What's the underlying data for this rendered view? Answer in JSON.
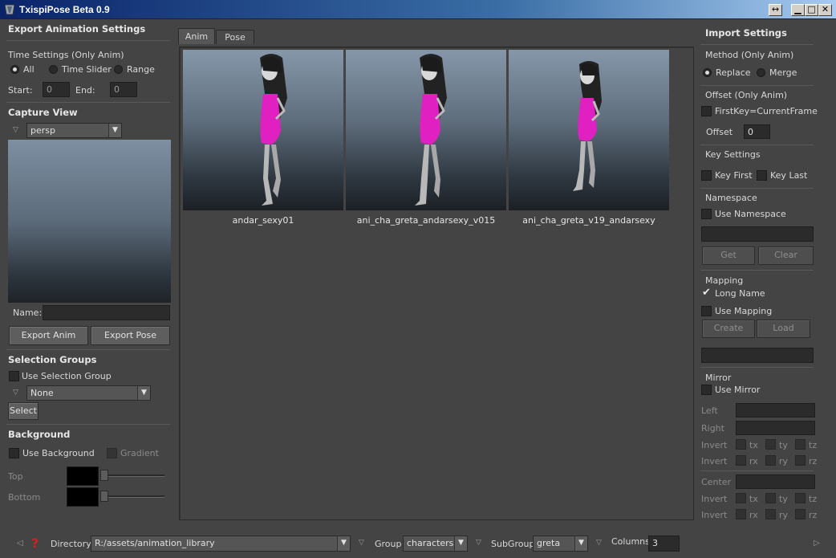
{
  "window": {
    "title": "TxispiPose Beta 0.9"
  },
  "export": {
    "title": "Export Animation Settings",
    "time_settings_label": "Time Settings (Only Anim)",
    "time_options": [
      "All",
      "Time Slider",
      "Range"
    ],
    "time_selected": "All",
    "start_label": "Start:",
    "start_value": "0",
    "end_label": "End:",
    "end_value": "0",
    "capture_view_title": "Capture View",
    "camera_value": "persp",
    "name_label": "Name:",
    "name_value": "",
    "export_anim_label": "Export Anim",
    "export_pose_label": "Export Pose"
  },
  "selection_groups": {
    "title": "Selection Groups",
    "use_label": "Use Selection Group",
    "group_value": "None",
    "select_label": "Select"
  },
  "background": {
    "title": "Background",
    "use_label": "Use Background",
    "gradient_label": "Gradient",
    "top_label": "Top",
    "bottom_label": "Bottom",
    "top_color": "#000000",
    "bottom_color": "#000000"
  },
  "tabs": [
    {
      "label": "Anim"
    },
    {
      "label": "Pose"
    }
  ],
  "active_tab": "Anim",
  "thumbnails": [
    {
      "caption": "andar_sexy01"
    },
    {
      "caption": "ani_cha_greta_andarsexy_v015"
    },
    {
      "caption": "ani_cha_greta_v19_andarsexy"
    }
  ],
  "import": {
    "title": "Import Settings",
    "method_label": "Method (Only Anim)",
    "method_options": [
      "Replace",
      "Merge"
    ],
    "method_selected": "Replace",
    "offset_section": "Offset (Only Anim)",
    "firstkey_label": "FirstKey=CurrentFrame",
    "offset_label": "Offset",
    "offset_value": "0",
    "key_settings": "Key Settings",
    "key_first": "Key First",
    "key_last": "Key Last",
    "namespace_section": "Namespace",
    "use_namespace": "Use Namespace",
    "namespace_value": "",
    "get_label": "Get",
    "clear_label": "Clear",
    "mapping_section": "Mapping",
    "long_name": "Long Name",
    "long_name_checked": true,
    "use_mapping": "Use Mapping",
    "create_label": "Create",
    "load_label": "Load",
    "mapping_value": "",
    "mirror_section": "Mirror",
    "use_mirror": "Use Mirror",
    "left_label": "Left",
    "right_label": "Right",
    "invert_label": "Invert",
    "center_label": "Center",
    "t_axes": [
      "tx",
      "ty",
      "tz"
    ],
    "r_axes": [
      "rx",
      "ry",
      "rz"
    ]
  },
  "bottom": {
    "directory_label": "Directory",
    "directory_value": "R:/assets/animation_library",
    "group_label": "Group",
    "group_value": "characters",
    "subgroup_label": "SubGroup",
    "subgroup_value": "greta",
    "columns_label": "Columns",
    "columns_value": "3"
  },
  "colors": {
    "background": "#444444",
    "character_dress": "#e020c0",
    "titlebar_start": "#0a246a"
  }
}
